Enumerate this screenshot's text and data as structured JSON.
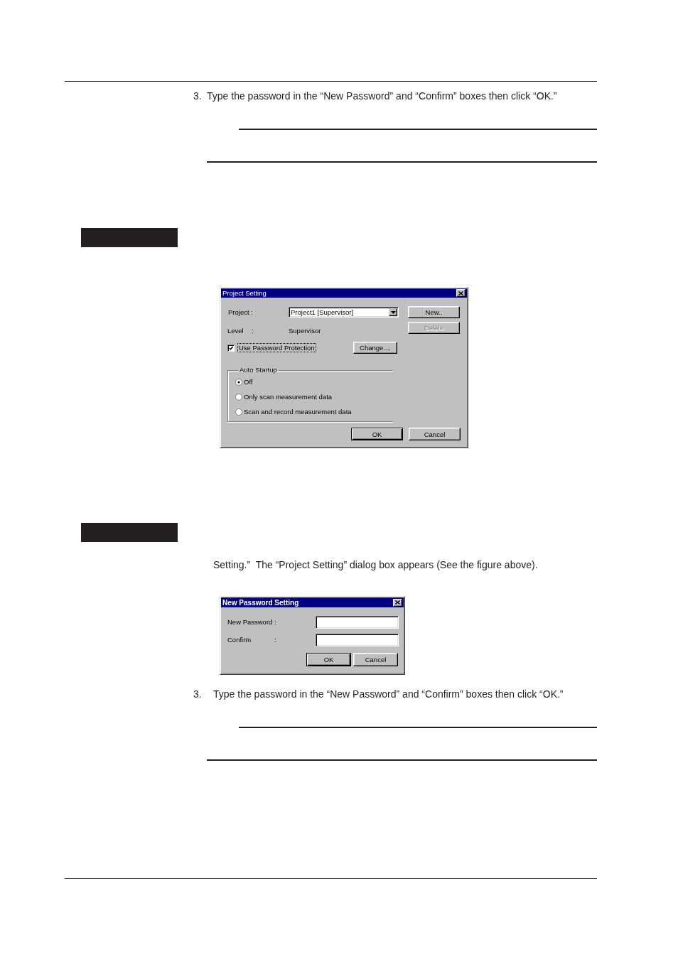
{
  "top_step": {
    "number": "3.",
    "text": "Type the password in the “New Password” and “Confirm” boxes then click “OK.”"
  },
  "project_dialog": {
    "title": "Project Setting",
    "project": {
      "label": "Project :",
      "value": "Project1 [Supervisor]"
    },
    "level": {
      "label": "Level",
      "separator": ":",
      "value": "Supervisor"
    },
    "side_buttons": [
      {
        "label": "New..",
        "disabled": false
      },
      {
        "label": "Delete",
        "disabled": true
      }
    ],
    "use_password": {
      "label": "Use Password Protection",
      "checked": true,
      "focused": true
    },
    "change_button": {
      "label": "Change...."
    },
    "auto_startup": {
      "label": "Auto Startup",
      "options": [
        {
          "label": "Off",
          "selected": true
        },
        {
          "label": "Only scan measurement data",
          "selected": false
        },
        {
          "label": "Scan and record measurement data",
          "selected": false
        }
      ]
    },
    "buttons": [
      {
        "label": "OK",
        "default": true
      },
      {
        "label": "Cancel",
        "default": false
      }
    ]
  },
  "instruction": {
    "text": "Setting.”  The “Project Setting” dialog box appears (See the figure above)."
  },
  "password_dialog": {
    "title": "New Password Setting",
    "fields": [
      {
        "label": "New Password",
        "separator": ":"
      },
      {
        "label": "Confirm",
        "separator": ":"
      }
    ],
    "buttons": [
      {
        "label": "OK",
        "default": true
      },
      {
        "label": "Cancel",
        "default": false
      }
    ]
  },
  "bottom_step": {
    "number": "3.",
    "text": "Type the password in the “New Password” and “Confirm” boxes then click “OK.”"
  }
}
